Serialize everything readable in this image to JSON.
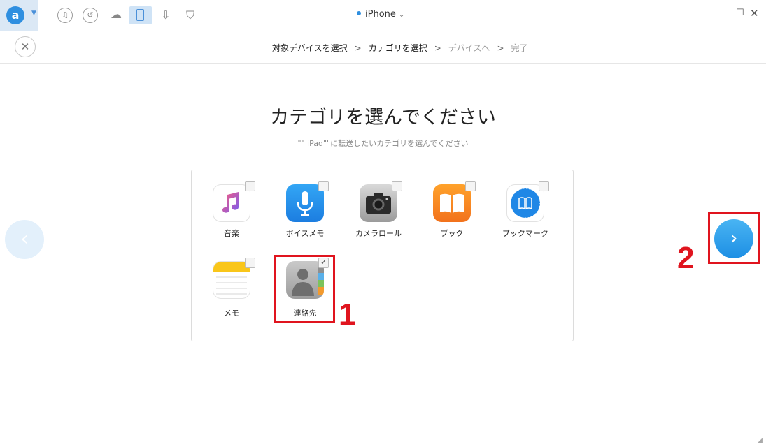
{
  "app": {
    "device_name": "iPhone",
    "logo_letter": "a"
  },
  "toolbar_icons": [
    {
      "name": "music-icon",
      "glyph": "♫"
    },
    {
      "name": "restore-icon",
      "glyph": "↺"
    },
    {
      "name": "cloud-icon",
      "glyph": "☁"
    },
    {
      "name": "phone-icon",
      "glyph": ""
    },
    {
      "name": "download-icon",
      "glyph": "⇩"
    },
    {
      "name": "tshirt-icon",
      "glyph": "👕"
    }
  ],
  "steps": {
    "step1": "対象デバイスを選択",
    "step2": "カテゴリを選択",
    "step3": "デバイスへ",
    "step4": "完了",
    "separator": ">"
  },
  "main": {
    "title": "カテゴリを選んでください",
    "subtitle": "\"\" iPad\"\"に転送したいカテゴリを選んでください"
  },
  "categories": [
    {
      "label": "音楽",
      "checked": false
    },
    {
      "label": "ボイスメモ",
      "checked": false
    },
    {
      "label": "カメラロール",
      "checked": false
    },
    {
      "label": "ブック",
      "checked": false
    },
    {
      "label": "ブックマーク",
      "checked": false
    },
    {
      "label": "メモ",
      "checked": false
    },
    {
      "label": "連絡先",
      "checked": true
    }
  ],
  "annotations": {
    "num1": "1",
    "num2": "2"
  },
  "colors": {
    "accent": "#2f8fe0",
    "annotation_red": "#e0141e"
  }
}
